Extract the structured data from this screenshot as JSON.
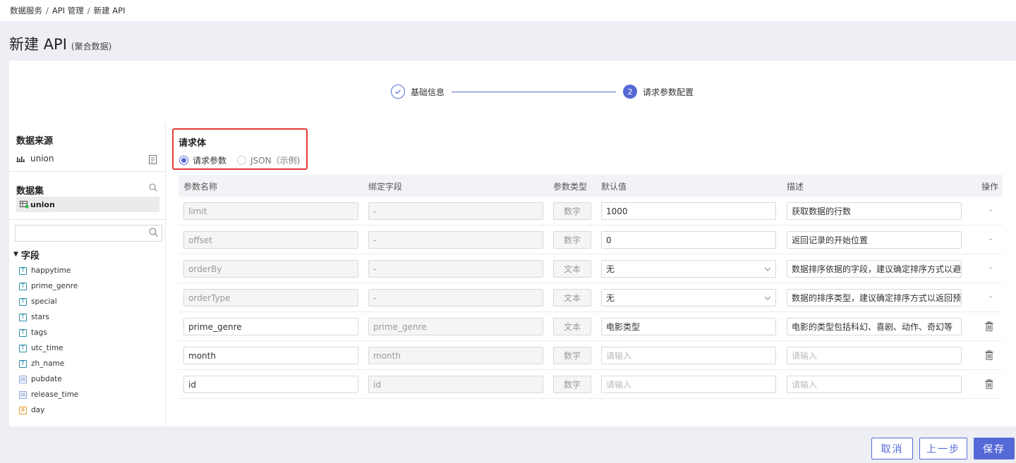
{
  "breadcrumb": [
    "数据服务",
    "API 管理",
    "新建 API"
  ],
  "breadcrumb_sep": "/",
  "page": {
    "title": "新建 API",
    "subtitle": "(聚合数据)"
  },
  "steps": [
    {
      "label": "基础信息",
      "status": "done"
    },
    {
      "label": "请求参数配置",
      "number": "2",
      "status": "active"
    }
  ],
  "left": {
    "source_title": "数据来源",
    "source_name": "union",
    "dataset_title": "数据集",
    "dataset_name": "union",
    "search_placeholder": "",
    "fields_title": "字段",
    "fields": [
      {
        "name": "happytime",
        "type": "text"
      },
      {
        "name": "prime_genre",
        "type": "text"
      },
      {
        "name": "special",
        "type": "text"
      },
      {
        "name": "stars",
        "type": "text"
      },
      {
        "name": "tags",
        "type": "text"
      },
      {
        "name": "utc_time",
        "type": "text"
      },
      {
        "name": "zh_name",
        "type": "text"
      },
      {
        "name": "pubdate",
        "type": "date"
      },
      {
        "name": "release_time",
        "type": "date"
      },
      {
        "name": "day",
        "type": "number"
      }
    ]
  },
  "request_body": {
    "title": "请求体",
    "option1": "请求参数",
    "option2": "JSON（示例)",
    "selected": "option1"
  },
  "table": {
    "headers": {
      "name": "参数名称",
      "bind": "绑定字段",
      "type": "参数类型",
      "default": "默认值",
      "desc": "描述",
      "op": "操作"
    },
    "rows": [
      {
        "name": "limit",
        "bind": "-",
        "type": "数字",
        "default": "1000",
        "desc": "获取数据的行数",
        "op": "-",
        "editable": false,
        "default_is_select": false
      },
      {
        "name": "offset",
        "bind": "-",
        "type": "数字",
        "default": "0",
        "desc": "返回记录的开始位置",
        "op": "-",
        "editable": false,
        "default_is_select": false
      },
      {
        "name": "orderBy",
        "bind": "-",
        "type": "文本",
        "default": "无",
        "desc": "数据排序依据的字段，建议确定排序方式以避",
        "op": "-",
        "editable": false,
        "default_is_select": true
      },
      {
        "name": "orderType",
        "bind": "-",
        "type": "文本",
        "default": "无",
        "desc": "数据的排序类型，建议确定排序方式以返回预",
        "op": "-",
        "editable": false,
        "default_is_select": true
      },
      {
        "name": "prime_genre",
        "bind": "prime_genre",
        "type": "文本",
        "default": "电影类型",
        "desc": "电影的类型包括科幻、喜剧、动作、奇幻等",
        "op": "trash-icon",
        "editable": true,
        "default_is_select": false
      },
      {
        "name": "month",
        "bind": "month",
        "type": "数字",
        "default": "",
        "default_placeholder": "请输入",
        "desc": "",
        "desc_placeholder": "请输入",
        "op": "trash-icon",
        "editable": true,
        "default_is_select": false
      },
      {
        "name": "id",
        "bind": "id",
        "type": "数字",
        "default": "",
        "default_placeholder": "请输入",
        "desc": "",
        "desc_placeholder": "请输入",
        "op": "trash-icon",
        "editable": true,
        "default_is_select": false
      }
    ]
  },
  "buttons": {
    "cancel": "取消",
    "prev": "上一步",
    "save": "保存"
  },
  "colors": {
    "accent": "#5569d6",
    "highlight_border": "#e53935"
  }
}
